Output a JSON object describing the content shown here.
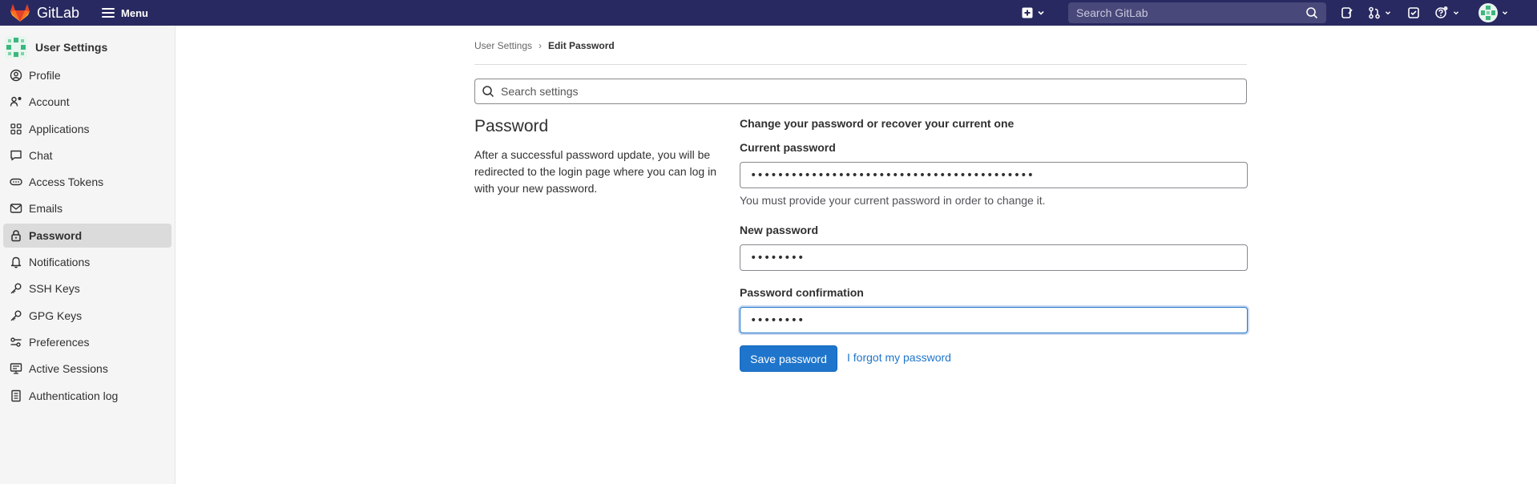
{
  "brand": {
    "name": "GitLab",
    "accent": "#fc6d26"
  },
  "topbar": {
    "menu_label": "Menu",
    "search_placeholder": "Search GitLab",
    "bg_color": "#292961"
  },
  "sidebar": {
    "title": "User Settings",
    "items": [
      {
        "label": "Profile",
        "icon": "profile-icon"
      },
      {
        "label": "Account",
        "icon": "account-icon"
      },
      {
        "label": "Applications",
        "icon": "applications-icon"
      },
      {
        "label": "Chat",
        "icon": "chat-icon"
      },
      {
        "label": "Access Tokens",
        "icon": "token-icon"
      },
      {
        "label": "Emails",
        "icon": "mail-icon"
      },
      {
        "label": "Password",
        "icon": "lock-icon",
        "active": true
      },
      {
        "label": "Notifications",
        "icon": "bell-icon"
      },
      {
        "label": "SSH Keys",
        "icon": "key-icon"
      },
      {
        "label": "GPG Keys",
        "icon": "key-icon"
      },
      {
        "label": "Preferences",
        "icon": "preferences-icon"
      },
      {
        "label": "Active Sessions",
        "icon": "monitor-icon"
      },
      {
        "label": "Authentication log",
        "icon": "log-icon"
      }
    ]
  },
  "breadcrumb": {
    "parent": "User Settings",
    "separator": "›",
    "current": "Edit Password"
  },
  "settings_search": {
    "placeholder": "Search settings"
  },
  "section": {
    "title": "Password",
    "description": "After a successful password update, you will be redirected to the login page where you can log in with your new password."
  },
  "form": {
    "heading": "Change your password or recover your current one",
    "current_password": {
      "label": "Current password",
      "value": "••••••••••••••••••••••••••••••••••••••••••",
      "help": "You must provide your current password in order to change it."
    },
    "new_password": {
      "label": "New password",
      "value": "••••••••"
    },
    "password_confirmation": {
      "label": "Password confirmation",
      "value": "••••••••"
    },
    "save_label": "Save password",
    "forgot_label": "I forgot my password"
  }
}
